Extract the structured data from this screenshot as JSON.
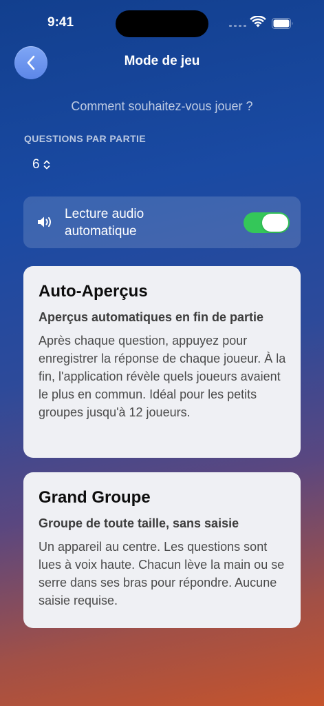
{
  "status_bar": {
    "time": "9:41"
  },
  "nav": {
    "title": "Mode de jeu"
  },
  "subtitle": "Comment souhaitez-vous jouer ?",
  "questions": {
    "label": "QUESTIONS PAR PARTIE",
    "value": "6"
  },
  "audio": {
    "label": "Lecture audio automatique",
    "enabled": true
  },
  "modes": [
    {
      "title": "Auto-Aperçus",
      "subtitle": "Aperçus automatiques en fin de partie",
      "description": "Après chaque question, appuyez pour enregistrer la réponse de chaque joueur. À la fin, l'application révèle quels joueurs avaient le plus en commun. Idéal pour les petits groupes jusqu'à 12 joueurs."
    },
    {
      "title": "Grand Groupe",
      "subtitle": "Groupe de toute taille, sans saisie",
      "description": "Un appareil au centre. Les questions sont lues à voix haute. Chacun lève la main ou se serre dans ses bras pour répondre. Aucune saisie requise."
    }
  ],
  "colors": {
    "toggle_on": "#34c759",
    "back_button": "#6b92ee"
  }
}
